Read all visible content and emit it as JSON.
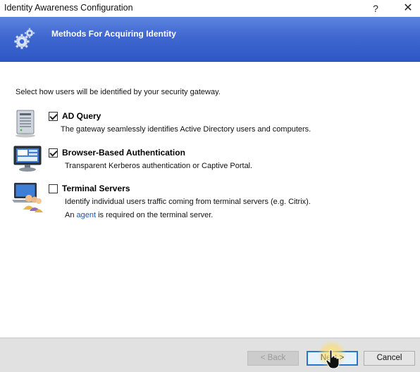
{
  "window": {
    "title": "Identity Awareness Configuration",
    "help_label": "?",
    "close_label": "✕"
  },
  "banner": {
    "heading": "Methods For Acquiring Identity",
    "icon": "gears-icon"
  },
  "intro": "Select how users will be identified by your security gateway.",
  "options": [
    {
      "title": "AD Query",
      "checked": true,
      "icon": "server-icon",
      "description": "The gateway seamlessly identifies Active Directory users and computers."
    },
    {
      "title": "Browser-Based Authentication",
      "checked": true,
      "icon": "monitor-icon",
      "description": "Transparent Kerberos authentication or Captive Portal."
    },
    {
      "title": "Terminal Servers",
      "checked": false,
      "icon": "laptop-users-icon",
      "description": "Identify individual users traffic coming from terminal servers (e.g. Citrix).",
      "note_prefix": "An ",
      "note_link": "agent",
      "note_suffix": " is required on the terminal server."
    }
  ],
  "buttons": {
    "back": "< Back",
    "next": "Next >",
    "cancel": "Cancel"
  },
  "colors": {
    "banner": "#3f67cf",
    "link": "#1a55b8",
    "focus_border": "#2a74c9"
  }
}
